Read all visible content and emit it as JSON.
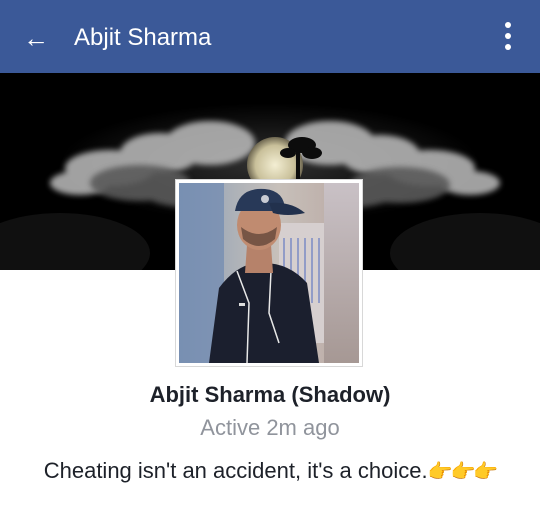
{
  "header": {
    "title": "Abjit Sharma",
    "back_icon": "arrow-left-icon",
    "more_icon": "vertical-dots-icon",
    "bg_color": "#3b5998"
  },
  "profile": {
    "name": "Abjit Sharma (Shadow)",
    "status": "Active 2m ago",
    "bio": "Cheating isn't an accident, it's a choice.",
    "bio_emoji": "👉👉👉"
  }
}
